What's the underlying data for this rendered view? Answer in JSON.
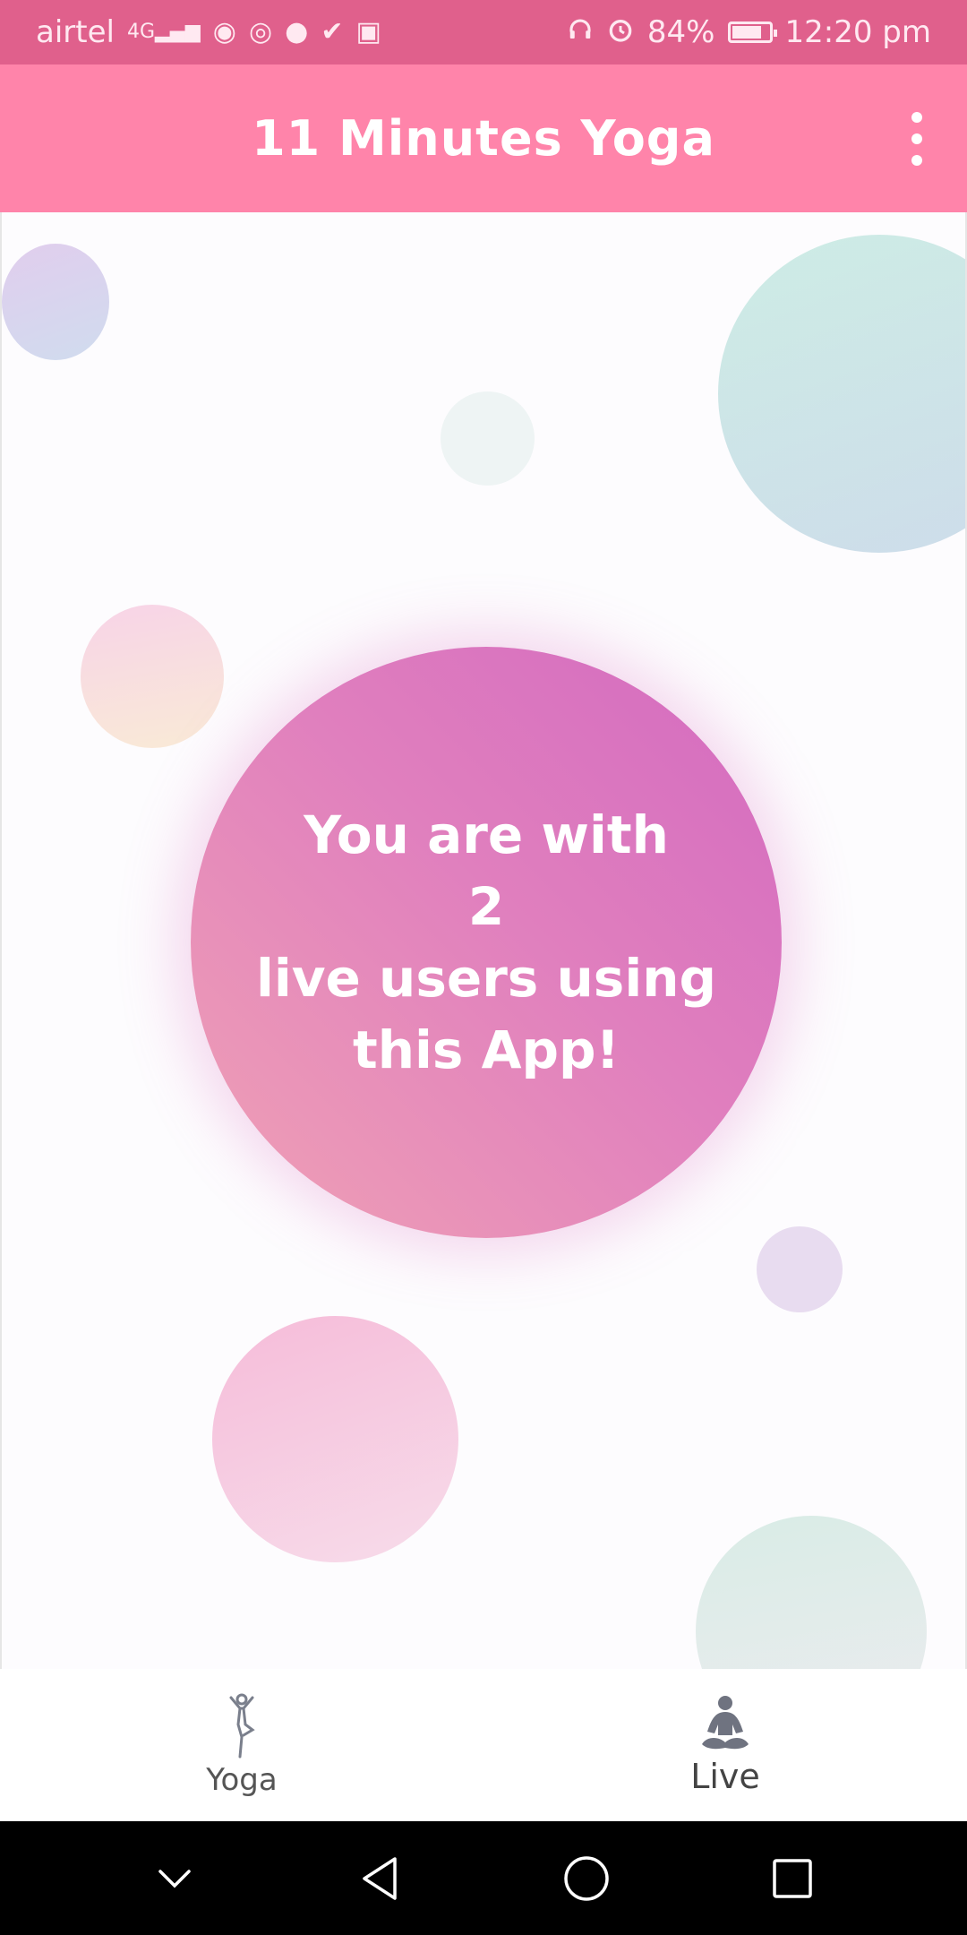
{
  "status_bar": {
    "carrier": "airtel",
    "network": "4G",
    "battery_percent": "84%",
    "battery_level": 0.84,
    "time": "12:20 pm",
    "icons": [
      "signal-icon",
      "hotspot-icon",
      "chrome-icon",
      "chat-icon",
      "check-icon",
      "sim-icon",
      "headphones-icon",
      "alarm-icon",
      "battery-icon"
    ]
  },
  "app_bar": {
    "title": "11 Minutes Yoga"
  },
  "live": {
    "line1": "You are with",
    "count": "2",
    "line3": "live users using",
    "line4": "this App!"
  },
  "bottom_nav": {
    "tabs": [
      {
        "label": "Yoga",
        "icon": "yoga-tree-pose-icon",
        "active": false
      },
      {
        "label": "Live",
        "icon": "meditation-icon",
        "active": true
      }
    ]
  },
  "colors": {
    "status_bar": "#e0608c",
    "app_bar": "#ff84aa",
    "live_circle_start": "#d36ac0",
    "live_circle_end": "#f0a2b4"
  }
}
